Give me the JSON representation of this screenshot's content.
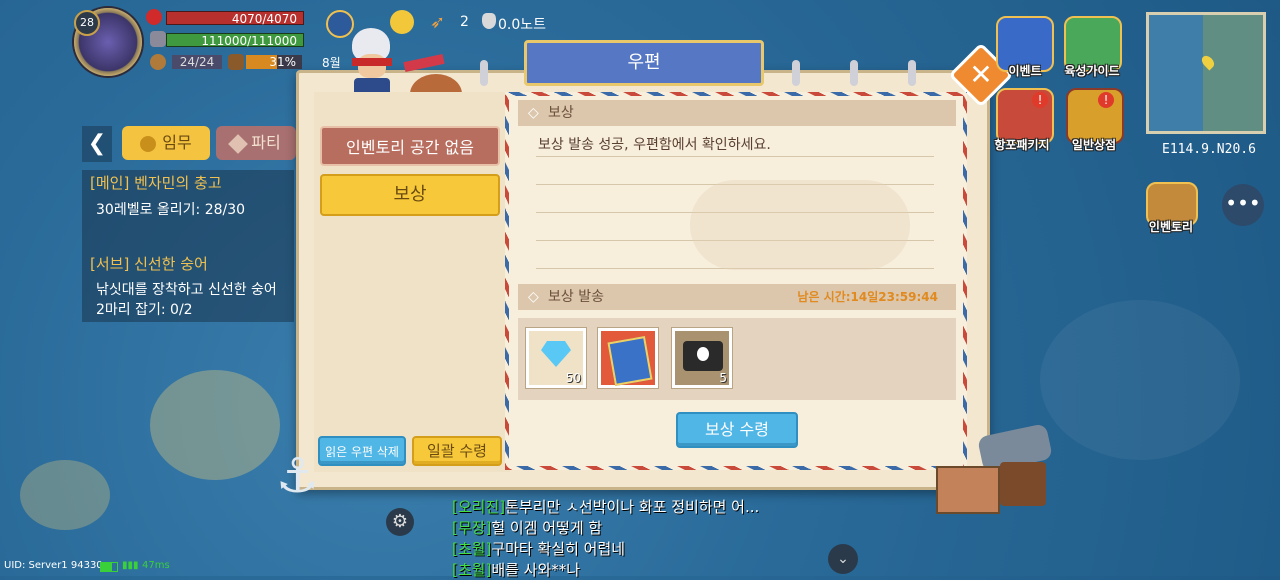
{
  "hud": {
    "level": "28",
    "hp": "4070/4070",
    "sp": "111000/111000",
    "food": "24/24",
    "ammo_pct": "31%",
    "energy_count": "2",
    "knots": "0.0노트",
    "day_partial": "8월"
  },
  "quests": {
    "tab_quest": "임무",
    "tab_party": "파티",
    "main_title": "[메인] 벤자민의 충고",
    "main_desc": "30레벨로 올리기: 28/30",
    "sub_title": "[서브] 신선한 숭어",
    "sub_desc_1": "낚싯대를 장착하고 신선한 숭어",
    "sub_desc_2": "2마리 잡기: 0/2"
  },
  "dialog": {
    "title": "우편",
    "left_header_btn": "인벤토리 공간 없음",
    "left_selected_item": "보상",
    "delete_read_btn": "읽은 우편 삭제",
    "claim_all_btn": "일괄 수령",
    "section_reward": "보상",
    "reward_message": "보상 발송 성공, 우편함에서 확인하세요.",
    "section_send": "보상 발송",
    "time_left": "남은 시간:14일23:59:44",
    "slots": [
      {
        "icon": "diamond-icon",
        "count": "50"
      },
      {
        "icon": "book-icon",
        "count": ""
      },
      {
        "icon": "pirate-flag-icon",
        "count": "5"
      }
    ],
    "claim_btn": "보상 수령"
  },
  "right_hud": {
    "event_label": "이벤트",
    "guide_label": "육성가이드",
    "package_label": "항포패키지",
    "shop_label": "일반상점",
    "inventory_label": "인벤토리",
    "coords": "E114.9.N20.6"
  },
  "chat": [
    {
      "tag": "[오리진]",
      "tag_color": "#44dd44",
      "text": "톤부리만 ㅅ선박이나 화포 정비하면 어..."
    },
    {
      "tag": "[무장]",
      "tag_color": "#44dd44",
      "text": "헐 이겜 어떻게 함"
    },
    {
      "tag": "[초월]",
      "tag_color": "#44dd44",
      "text": "구마타 확실히 어렵네"
    },
    {
      "tag": "[초월]",
      "tag_color": "#44dd44",
      "text": "배를 사와**나"
    }
  ],
  "status": {
    "uid": "UID: Server1 94330",
    "ping": "47ms"
  }
}
